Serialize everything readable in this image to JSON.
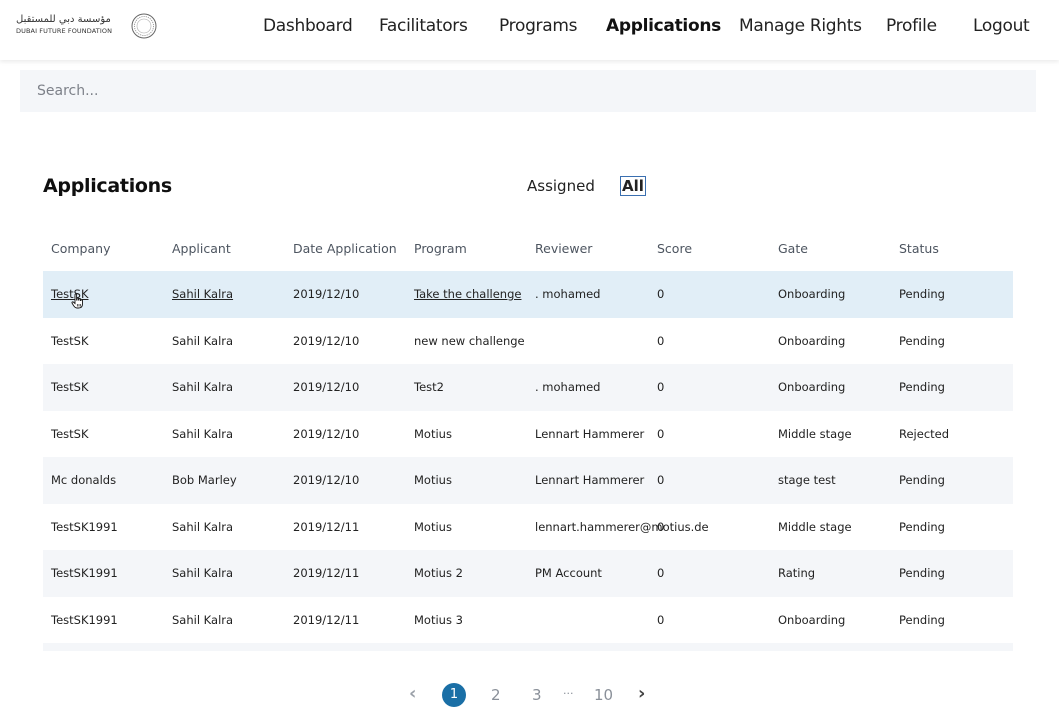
{
  "logo": {
    "arabic": "مؤسسة دبي للمستقبل",
    "english": "DUBAI FUTURE FOUNDATION"
  },
  "nav": {
    "items": [
      {
        "label": "Dashboard"
      },
      {
        "label": "Facilitators"
      },
      {
        "label": "Programs"
      },
      {
        "label": "Applications",
        "active": true
      },
      {
        "label": "Manage Rights"
      },
      {
        "label": "Profile"
      },
      {
        "label": "Logout"
      }
    ]
  },
  "search": {
    "placeholder": "Search..."
  },
  "page": {
    "title": "Applications",
    "filters": {
      "assigned": "Assigned",
      "all": "All",
      "selected": "All"
    }
  },
  "table": {
    "columns": [
      "Company",
      "Applicant",
      "Date Application",
      "Program",
      "Reviewer",
      "Score",
      "Gate",
      "Status"
    ],
    "rows": [
      [
        "TestSK",
        "Sahil Kalra",
        "2019/12/10",
        "Take the challenge",
        ". mohamed",
        "0",
        "Onboarding",
        "Pending"
      ],
      [
        "TestSK",
        "Sahil Kalra",
        "2019/12/10",
        "new new challenge",
        "",
        "0",
        "Onboarding",
        "Pending"
      ],
      [
        "TestSK",
        "Sahil Kalra",
        "2019/12/10",
        "Test2",
        ". mohamed",
        "0",
        "Onboarding",
        "Pending"
      ],
      [
        "TestSK",
        "Sahil Kalra",
        "2019/12/10",
        "Motius",
        "Lennart Hammerer",
        "0",
        "Middle stage",
        "Rejected"
      ],
      [
        "Mc donalds",
        "Bob Marley",
        "2019/12/10",
        "Motius",
        "Lennart Hammerer",
        "0",
        "stage test",
        "Pending"
      ],
      [
        "TestSK1991",
        "Sahil Kalra",
        "2019/12/11",
        "Motius",
        "lennart.hammerer@motius.de",
        "0",
        "Middle stage",
        "Pending"
      ],
      [
        "TestSK1991",
        "Sahil Kalra",
        "2019/12/11",
        "Motius 2",
        "PM Account",
        "0",
        "Rating",
        "Pending"
      ],
      [
        "TestSK1991",
        "Sahil Kalra",
        "2019/12/11",
        "Motius 3",
        "",
        "0",
        "Onboarding",
        "Pending"
      ]
    ]
  },
  "pagination": {
    "prev_icon": "chevron-left-icon",
    "pages": [
      "1",
      "2",
      "3"
    ],
    "ellipsis": "···",
    "last": "10",
    "current": "1",
    "next_icon": "chevron-right-icon"
  },
  "colors": {
    "accent": "#1a6fa6",
    "row_alt": "#f4f6f9",
    "row_highlight": "#e1eef7"
  }
}
